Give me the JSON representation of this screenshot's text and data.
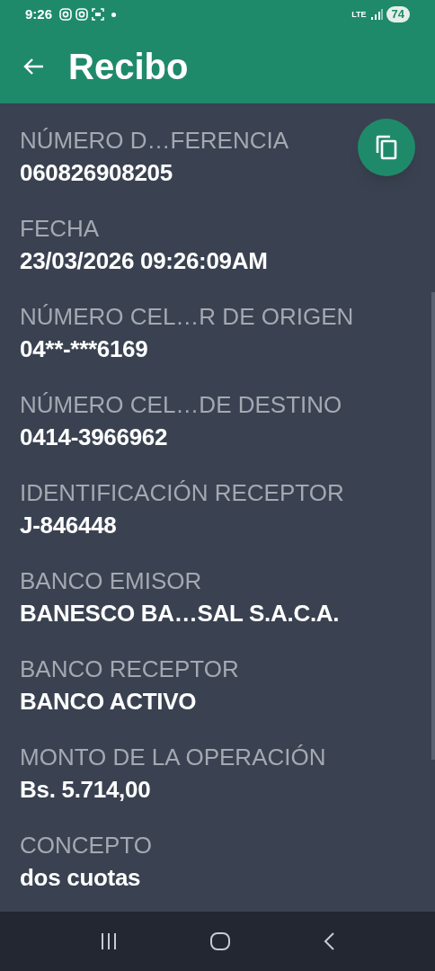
{
  "status_bar": {
    "time": "9:26",
    "network": "LTE",
    "battery": "74"
  },
  "app_bar": {
    "title": "Recibo"
  },
  "fields": [
    {
      "label": "NÚMERO D…FERENCIA",
      "value": "060826908205"
    },
    {
      "label": "FECHA",
      "value": "23/03/2026 09:26:09AM"
    },
    {
      "label": "NÚMERO CEL…R DE ORIGEN",
      "value": "04**-***6169"
    },
    {
      "label": "NÚMERO CEL…DE DESTINO",
      "value": "0414-3966962"
    },
    {
      "label": "IDENTIFICACIÓN RECEPTOR",
      "value": "J-846448"
    },
    {
      "label": "BANCO EMISOR",
      "value": "BANESCO BA…SAL S.A.C.A."
    },
    {
      "label": "BANCO RECEPTOR",
      "value": "BANCO ACTIVO"
    },
    {
      "label": "MONTO DE LA OPERACIÓN",
      "value": "Bs. 5.714,00"
    },
    {
      "label": "CONCEPTO",
      "value": "dos cuotas"
    }
  ]
}
